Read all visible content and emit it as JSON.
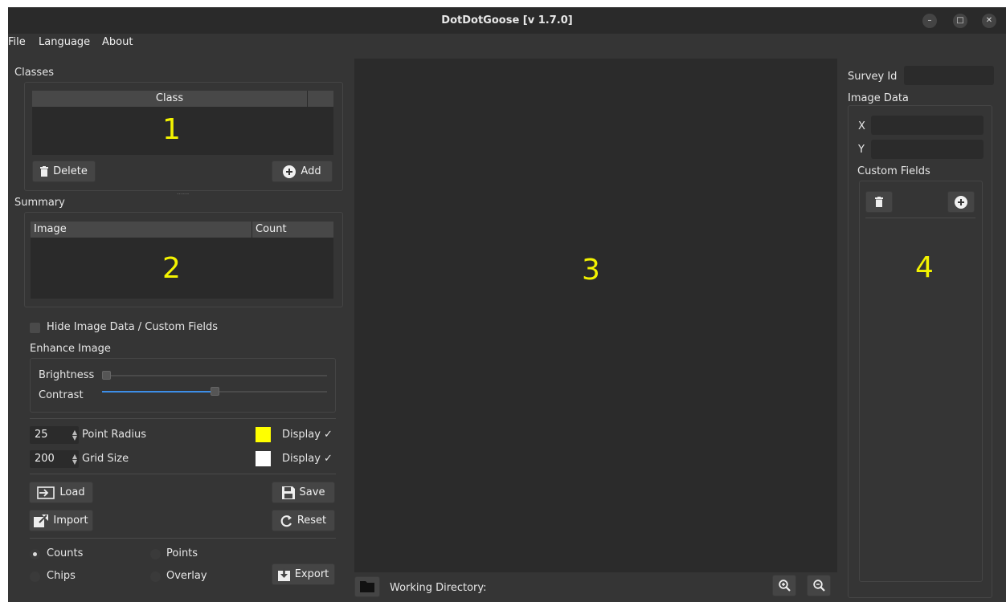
{
  "window": {
    "title": "DotDotGoose [v 1.7.0]"
  },
  "menu": [
    "File",
    "Language",
    "About"
  ],
  "classes": {
    "title": "Classes",
    "column": "Class",
    "marker": "1",
    "delete_label": "Delete",
    "add_label": "Add"
  },
  "summary": {
    "title": "Summary",
    "columns": [
      "Image",
      "Count"
    ],
    "marker": "2"
  },
  "hide_image_data_label": "Hide Image Data / Custom Fields",
  "enhance": {
    "title": "Enhance Image",
    "brightness_label": "Brightness",
    "brightness_value": 0.0,
    "contrast_label": "Contrast",
    "contrast_value": 0.5
  },
  "point_radius": {
    "value": "25",
    "label": "Point Radius",
    "color": "#ffff00",
    "display_label": "Display ✓"
  },
  "grid_size": {
    "value": "200",
    "label": "Grid Size",
    "color": "#ffffff",
    "display_label": "Display ✓"
  },
  "buttons": {
    "load": "Load",
    "save": "Save",
    "import": "Import",
    "reset": "Reset",
    "export": "Export"
  },
  "export_options": {
    "counts": "Counts",
    "points": "Points",
    "chips": "Chips",
    "overlay": "Overlay",
    "selected": "Counts"
  },
  "canvas": {
    "marker": "3"
  },
  "status": {
    "working_directory_label": "Working Directory:"
  },
  "right_panel": {
    "survey_id_label": "Survey Id",
    "image_data_title": "Image Data",
    "x_label": "X",
    "y_label": "Y",
    "custom_fields_title": "Custom Fields",
    "marker": "4"
  },
  "colors": {
    "accent": "#3d8ee8",
    "marker": "#f3f300"
  }
}
